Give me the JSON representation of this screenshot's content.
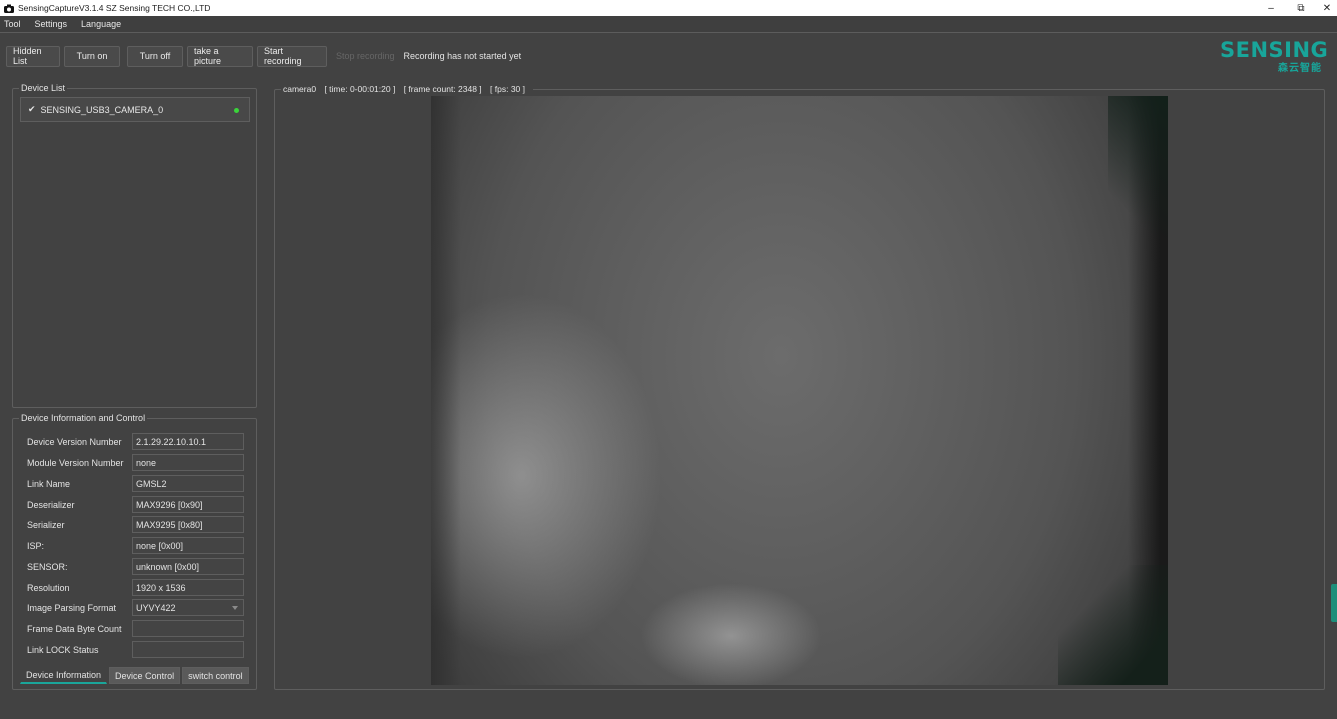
{
  "window": {
    "title": "SensingCaptureV3.1.4 SZ Sensing TECH CO.,LTD",
    "controls": {
      "minimize": "–",
      "maximize": "⧉",
      "close": "✕"
    }
  },
  "menu": [
    "Tool",
    "Settings",
    "Language"
  ],
  "toolbar": {
    "hidden_list": "Hidden List",
    "turn_on": "Turn on",
    "turn_off": "Turn off",
    "take_picture": "take a picture",
    "start_recording": "Start recording",
    "stop_recording": "Stop recording",
    "status": "Recording has not started yet"
  },
  "logo": {
    "text": "SENSING",
    "subtext": "森云智能",
    "color": "#18a59a"
  },
  "device_list": {
    "title": "Device List",
    "items": [
      {
        "name": "SENSING_USB3_CAMERA_0",
        "checked": "✔",
        "status_color": "#3ad43a"
      }
    ]
  },
  "device_info": {
    "title": "Device Information and Control",
    "rows": [
      {
        "label": "Device Version Number",
        "value": "2.1.29.22.10.10.1"
      },
      {
        "label": "Module Version Number",
        "value": "none"
      },
      {
        "label": "Link Name",
        "value": "GMSL2"
      },
      {
        "label": "Deserializer",
        "value": "MAX9296 [0x90]"
      },
      {
        "label": "Serializer",
        "value": "MAX9295 [0x80]"
      },
      {
        "label": "ISP:",
        "value": "none [0x00]"
      },
      {
        "label": "SENSOR:",
        "value": "unknown [0x00]"
      },
      {
        "label": "Resolution",
        "value": "1920 x 1536"
      },
      {
        "label": "Image Parsing Format",
        "value": "UYVY422"
      },
      {
        "label": "Frame Data Byte Count",
        "value": ""
      },
      {
        "label": "Link LOCK Status",
        "value": ""
      }
    ],
    "tabs": [
      "Device Information",
      "Device Control",
      "switch control"
    ]
  },
  "camera": {
    "name": "camera0",
    "time": "[ time: 0-00:01:20 ]",
    "frame_count": "[ frame count: 2348 ]",
    "fps": "[ fps: 30 ]"
  },
  "colors": {
    "accent": "#1aa59a",
    "background": "#424242"
  }
}
